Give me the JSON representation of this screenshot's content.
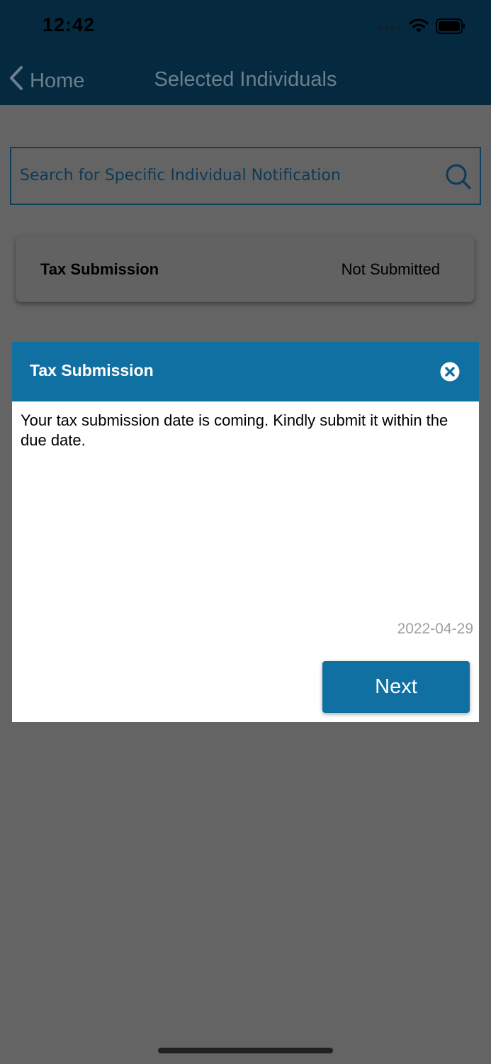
{
  "status_bar": {
    "time": "12:42"
  },
  "nav": {
    "back_label": "Home",
    "title": "Selected Individuals"
  },
  "search": {
    "placeholder": "Search for Specific Individual Notification",
    "value": ""
  },
  "list": {
    "items": [
      {
        "title": "Tax Submission",
        "status": "Not Submitted"
      }
    ]
  },
  "modal": {
    "title": "Tax Submission",
    "message": "Your tax submission date is coming. Kindly submit it within the due date.",
    "date": "2022-04-29",
    "next_label": "Next"
  },
  "colors": {
    "nav_background": "#052a40",
    "accent": "#1170a2",
    "overlay": "#646464"
  },
  "icons": {
    "back": "chevron-left-icon",
    "search": "search-icon",
    "close": "close-icon",
    "signal": "signal-icon",
    "wifi": "wifi-icon",
    "battery": "battery-icon"
  }
}
